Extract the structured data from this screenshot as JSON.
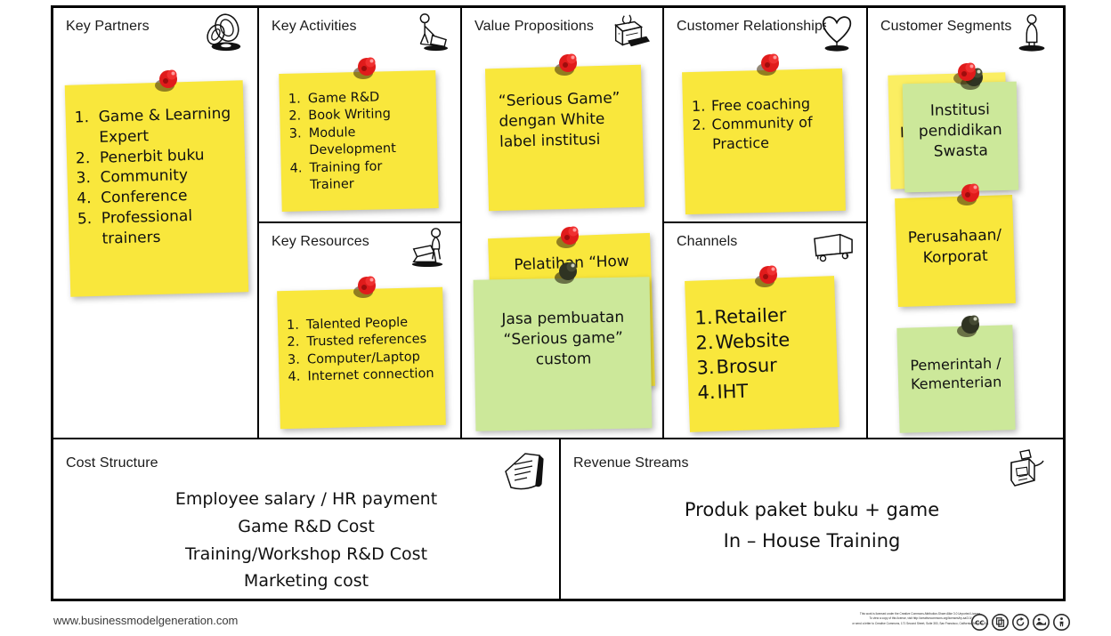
{
  "canvas": {
    "blocks": {
      "key_partners": {
        "title": "Key Partners",
        "icon": "chain-links-icon",
        "note": {
          "color": "#f9e73c",
          "items": [
            "Game & Learning Expert",
            "Penerbit buku",
            "Community",
            "Conference",
            "Professional trainers"
          ]
        }
      },
      "key_activities": {
        "title": "Key Activities",
        "icon": "worker-sweeping-icon",
        "note": {
          "color": "#f9e73c",
          "items": [
            "Game R&D",
            "Book Writing",
            "Module Development",
            "Training for Trainer"
          ]
        }
      },
      "key_resources": {
        "title": "Key Resources",
        "icon": "worker-forklift-icon",
        "note": {
          "color": "#f9e73c",
          "items": [
            "Talented People",
            "Trusted references",
            "Computer/Laptop",
            "Internet connection"
          ]
        }
      },
      "value_propositions": {
        "title": "Value Propositions",
        "icon": "gift-package-icon",
        "notes": [
          {
            "color": "#f9e73c",
            "text": "“Serious Game” dengan White label institusi"
          },
          {
            "color": "#f9e73c",
            "text": "Pelatihan “How"
          },
          {
            "color": "#cce89a",
            "text": "Jasa pembuatan “Serious game” custom"
          }
        ]
      },
      "customer_relationships": {
        "title": "Customer Relationships",
        "icon": "heart-icon",
        "note": {
          "color": "#f9e73c",
          "items": [
            "Free coaching",
            "Community of Practice"
          ]
        }
      },
      "channels": {
        "title": "Channels",
        "icon": "delivery-truck-icon",
        "note": {
          "color": "#f9e73c",
          "items": [
            "Retailer",
            "Website",
            "Brosur",
            "IHT"
          ]
        }
      },
      "customer_segments": {
        "title": "Customer Segments",
        "icon": "person-standing-icon",
        "notes": [
          {
            "color": "#fbee62",
            "text": "I"
          },
          {
            "color": "#cce89a",
            "text": "Institusi pendidikan Swasta"
          },
          {
            "color": "#f9e73c",
            "text": "Perusahaan/ Korporat"
          },
          {
            "color": "#cce89a",
            "text": "Pemerintah / Kementerian"
          }
        ]
      },
      "cost_structure": {
        "title": "Cost Structure",
        "icon": "invoice-paper-icon",
        "lines": [
          "Employee salary / HR payment",
          "Game R&D Cost",
          "Training/Workshop R&D Cost",
          "Marketing cost"
        ]
      },
      "revenue_streams": {
        "title": "Revenue Streams",
        "icon": "cash-register-icon",
        "lines": [
          "Produk paket buku + game",
          "In – House Training"
        ]
      }
    }
  },
  "footer": {
    "url": "www.businessmodelgeneration.com",
    "license_line_1": "This work is licensed under the Creative Commons Attribution-Share Alike 3.0 Unported License.",
    "license_line_2": "To view a copy of this license, visit http://creativecommons.org/licenses/by-sa/3.0/",
    "license_line_3": "or send a letter to Creative Commons, 171 Second Street, Suite 300, San Francisco, California, 94105, USA.",
    "badges": [
      "cc-icon",
      "copy-icon",
      "share-alike-icon",
      "remix-icon",
      "attribution-icon"
    ]
  }
}
